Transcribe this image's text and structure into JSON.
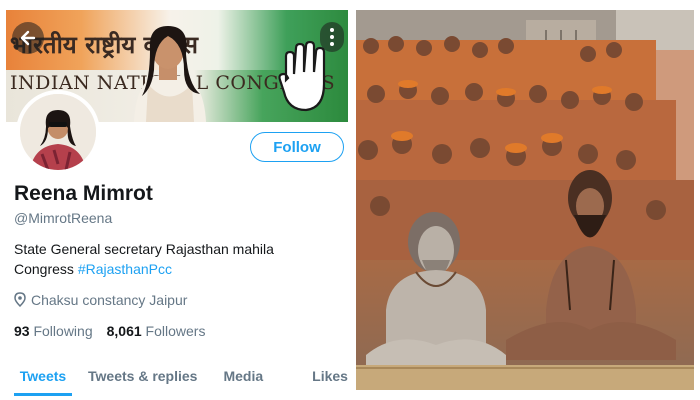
{
  "profile": {
    "banner": {
      "hindi_text": "भारतीय राष्ट्रीय कांग्रेस",
      "english_text": "INDIAN NATIONAL CONGRESS"
    },
    "back_icon": "arrow-left-icon",
    "more_icon": "more-vertical-icon",
    "follow_label": "Follow",
    "name": "Reena Mimrot",
    "handle": "@MimrotReena",
    "bio_text": "State  General secretary Rajasthan mahila Congress",
    "bio_hashtag": "#RajasthanPcc",
    "location": "Chaksu constancy Jaipur",
    "following_count": "93",
    "following_label": "Following",
    "followers_count": "8,061",
    "followers_label": "Followers",
    "tabs": [
      {
        "label": "Tweets"
      },
      {
        "label": "Tweets & replies"
      },
      {
        "label": "Media"
      },
      {
        "label": "Likes"
      }
    ],
    "accent_color": "#1da1f2"
  },
  "photo": {
    "content": "crowd of sadhus seated outdoors"
  }
}
